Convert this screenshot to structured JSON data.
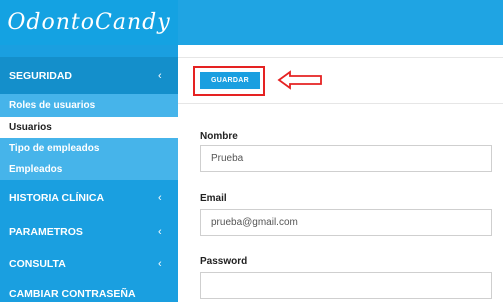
{
  "app": {
    "logo_text": "OdontoCandy"
  },
  "sidebar": {
    "sections": [
      {
        "label": "SEGURIDAD",
        "chevron": "‹"
      },
      {
        "label": "HISTORIA CLÍNICA",
        "chevron": "‹"
      },
      {
        "label": "PARAMETROS",
        "chevron": "‹"
      },
      {
        "label": "CONSULTA",
        "chevron": "‹"
      },
      {
        "label": "CAMBIAR CONTRASEÑA"
      }
    ],
    "sub_items": [
      {
        "label": "Roles de usuarios"
      },
      {
        "label": "Usuarios"
      },
      {
        "label": "Tipo de empleados"
      },
      {
        "label": "Empleados"
      }
    ]
  },
  "toolbar": {
    "save_label": "GUARDAR"
  },
  "form": {
    "name_label": "Nombre",
    "name_value": "Prueba",
    "email_label": "Email",
    "email_value": "prueba@gmail.com",
    "password_label": "Password",
    "password_value": ""
  },
  "colors": {
    "primary": "#1a9fe0",
    "highlight": "#e52222"
  }
}
